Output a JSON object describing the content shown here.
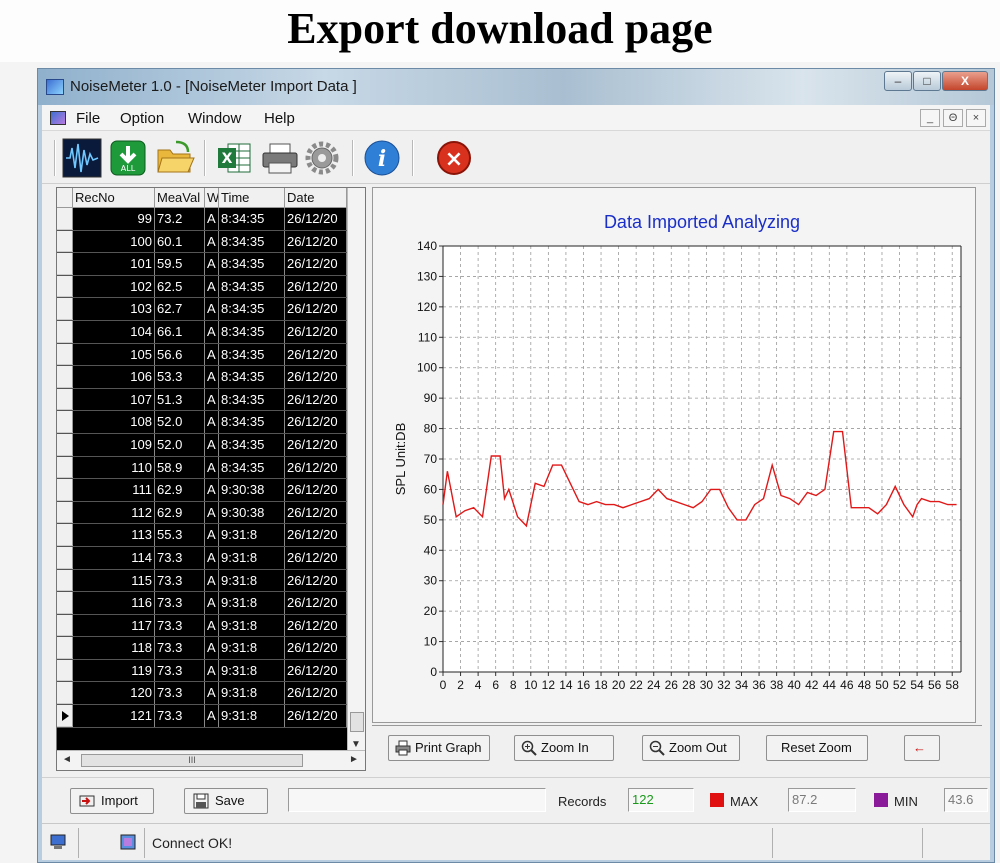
{
  "page_heading": "Export download page",
  "window": {
    "title": "NoiseMeter 1.0  - [NoiseMeter Import Data ]",
    "controls": {
      "minimize": "–",
      "maximize": "□",
      "close": "X"
    }
  },
  "menu": {
    "items": [
      "File",
      "Option",
      "Window",
      "Help"
    ],
    "mdi_controls": [
      "_",
      "Θ",
      "×"
    ]
  },
  "toolbar": {
    "buttons": [
      {
        "name": "waveform-icon"
      },
      {
        "name": "download-all-icon",
        "label": "ALL"
      },
      {
        "name": "open-folder-icon"
      },
      {
        "name": "excel-export-icon",
        "label": "X"
      },
      {
        "name": "printer-icon"
      },
      {
        "name": "settings-gear-icon"
      },
      {
        "name": "info-icon",
        "label": "i"
      },
      {
        "name": "exit-icon",
        "label": "×"
      }
    ]
  },
  "grid": {
    "columns": [
      "RecNo",
      "MeaVal",
      "W",
      "Time",
      "Date"
    ],
    "rows": [
      {
        "recno": "99",
        "value": "73.2",
        "w": "A",
        "time": "8:34:35",
        "date": "26/12/20"
      },
      {
        "recno": "100",
        "value": "60.1",
        "w": "A",
        "time": "8:34:35",
        "date": "26/12/20"
      },
      {
        "recno": "101",
        "value": "59.5",
        "w": "A",
        "time": "8:34:35",
        "date": "26/12/20"
      },
      {
        "recno": "102",
        "value": "62.5",
        "w": "A",
        "time": "8:34:35",
        "date": "26/12/20"
      },
      {
        "recno": "103",
        "value": "62.7",
        "w": "A",
        "time": "8:34:35",
        "date": "26/12/20"
      },
      {
        "recno": "104",
        "value": "66.1",
        "w": "A",
        "time": "8:34:35",
        "date": "26/12/20"
      },
      {
        "recno": "105",
        "value": "56.6",
        "w": "A",
        "time": "8:34:35",
        "date": "26/12/20"
      },
      {
        "recno": "106",
        "value": "53.3",
        "w": "A",
        "time": "8:34:35",
        "date": "26/12/20"
      },
      {
        "recno": "107",
        "value": "51.3",
        "w": "A",
        "time": "8:34:35",
        "date": "26/12/20"
      },
      {
        "recno": "108",
        "value": "52.0",
        "w": "A",
        "time": "8:34:35",
        "date": "26/12/20"
      },
      {
        "recno": "109",
        "value": "52.0",
        "w": "A",
        "time": "8:34:35",
        "date": "26/12/20"
      },
      {
        "recno": "110",
        "value": "58.9",
        "w": "A",
        "time": "8:34:35",
        "date": "26/12/20"
      },
      {
        "recno": "111",
        "value": "62.9",
        "w": "A",
        "time": "9:30:38",
        "date": "26/12/20"
      },
      {
        "recno": "112",
        "value": "62.9",
        "w": "A",
        "time": "9:30:38",
        "date": "26/12/20"
      },
      {
        "recno": "113",
        "value": "55.3",
        "w": "A",
        "time": "9:31:8",
        "date": "26/12/20"
      },
      {
        "recno": "114",
        "value": "73.3",
        "w": "A",
        "time": "9:31:8",
        "date": "26/12/20"
      },
      {
        "recno": "115",
        "value": "73.3",
        "w": "A",
        "time": "9:31:8",
        "date": "26/12/20"
      },
      {
        "recno": "116",
        "value": "73.3",
        "w": "A",
        "time": "9:31:8",
        "date": "26/12/20"
      },
      {
        "recno": "117",
        "value": "73.3",
        "w": "A",
        "time": "9:31:8",
        "date": "26/12/20"
      },
      {
        "recno": "118",
        "value": "73.3",
        "w": "A",
        "time": "9:31:8",
        "date": "26/12/20"
      },
      {
        "recno": "119",
        "value": "73.3",
        "w": "A",
        "time": "9:31:8",
        "date": "26/12/20"
      },
      {
        "recno": "120",
        "value": "73.3",
        "w": "A",
        "time": "9:31:8",
        "date": "26/12/20"
      },
      {
        "recno": "121",
        "value": "73.3",
        "w": "A",
        "time": "9:31:8",
        "date": "26/12/20",
        "current": true
      }
    ],
    "hscroll_thumb_label": "III"
  },
  "chart_data": {
    "type": "line",
    "title": "Data Imported  Analyzing",
    "xlabel": "",
    "ylabel": "SPL  Unit:DB",
    "xlim": [
      0,
      59
    ],
    "ylim": [
      0,
      140
    ],
    "xticks": [
      0,
      2,
      4,
      6,
      8,
      10,
      12,
      14,
      16,
      18,
      20,
      22,
      24,
      26,
      28,
      30,
      32,
      34,
      36,
      38,
      40,
      42,
      44,
      46,
      48,
      50,
      52,
      54,
      56,
      58
    ],
    "yticks": [
      0,
      10,
      20,
      30,
      40,
      50,
      60,
      70,
      80,
      90,
      100,
      110,
      120,
      130,
      140
    ],
    "grid": true,
    "line_color": "#e01818",
    "series": [
      {
        "x": [
          0,
          0.5,
          1.5,
          2.5,
          3.5,
          4.5,
          5.5,
          6.5,
          7,
          7.5,
          8.5,
          9.5,
          10.5,
          11.5,
          12.5,
          13.5,
          14.5,
          15.5,
          16.5,
          17.5,
          18.5,
          19.5,
          20.5,
          21.5,
          22.5,
          23.5,
          24.5,
          25.5,
          26.5,
          27.5,
          28.5,
          29.5,
          30.5,
          31.5,
          32.5,
          33.5,
          34.5,
          35.5,
          36.5,
          37.5,
          38.5,
          39.5,
          40.5,
          41.5,
          42.5,
          43.5,
          44.5,
          45.5,
          46.5,
          47.5,
          48.5,
          49.5,
          50.5,
          51.5,
          52.5,
          53.5,
          54,
          54.5,
          55.5,
          56.5,
          57.5,
          58.5
        ],
        "y": [
          55,
          66,
          51,
          53,
          54,
          51,
          71,
          71,
          57,
          60,
          51,
          48,
          62,
          61,
          68,
          68,
          62,
          56,
          55,
          56,
          55,
          55,
          54,
          55,
          56,
          57,
          60,
          57,
          56,
          55,
          54,
          56,
          60,
          60,
          54,
          50,
          50,
          55,
          57,
          68,
          58,
          57,
          55,
          59,
          58,
          60,
          79,
          79,
          54,
          54,
          54,
          52,
          55,
          61,
          55,
          51,
          55,
          57,
          56,
          56,
          55,
          55
        ]
      }
    ]
  },
  "chart_toolbar": {
    "buttons": [
      "Print Graph",
      "Zoom In",
      "Zoom Out",
      "Reset Zoom"
    ],
    "arrow": "←"
  },
  "bottom_bar": {
    "import_label": "Import",
    "save_label": "Save",
    "message": "",
    "records_label": "Records",
    "records_value": "122",
    "max_label": "MAX",
    "max_value": "87.2",
    "max_color": "#e01010",
    "min_label": "MIN",
    "min_value": "43.6",
    "min_color": "#8a1a9a"
  },
  "status_bar": {
    "text": "Connect OK!"
  }
}
